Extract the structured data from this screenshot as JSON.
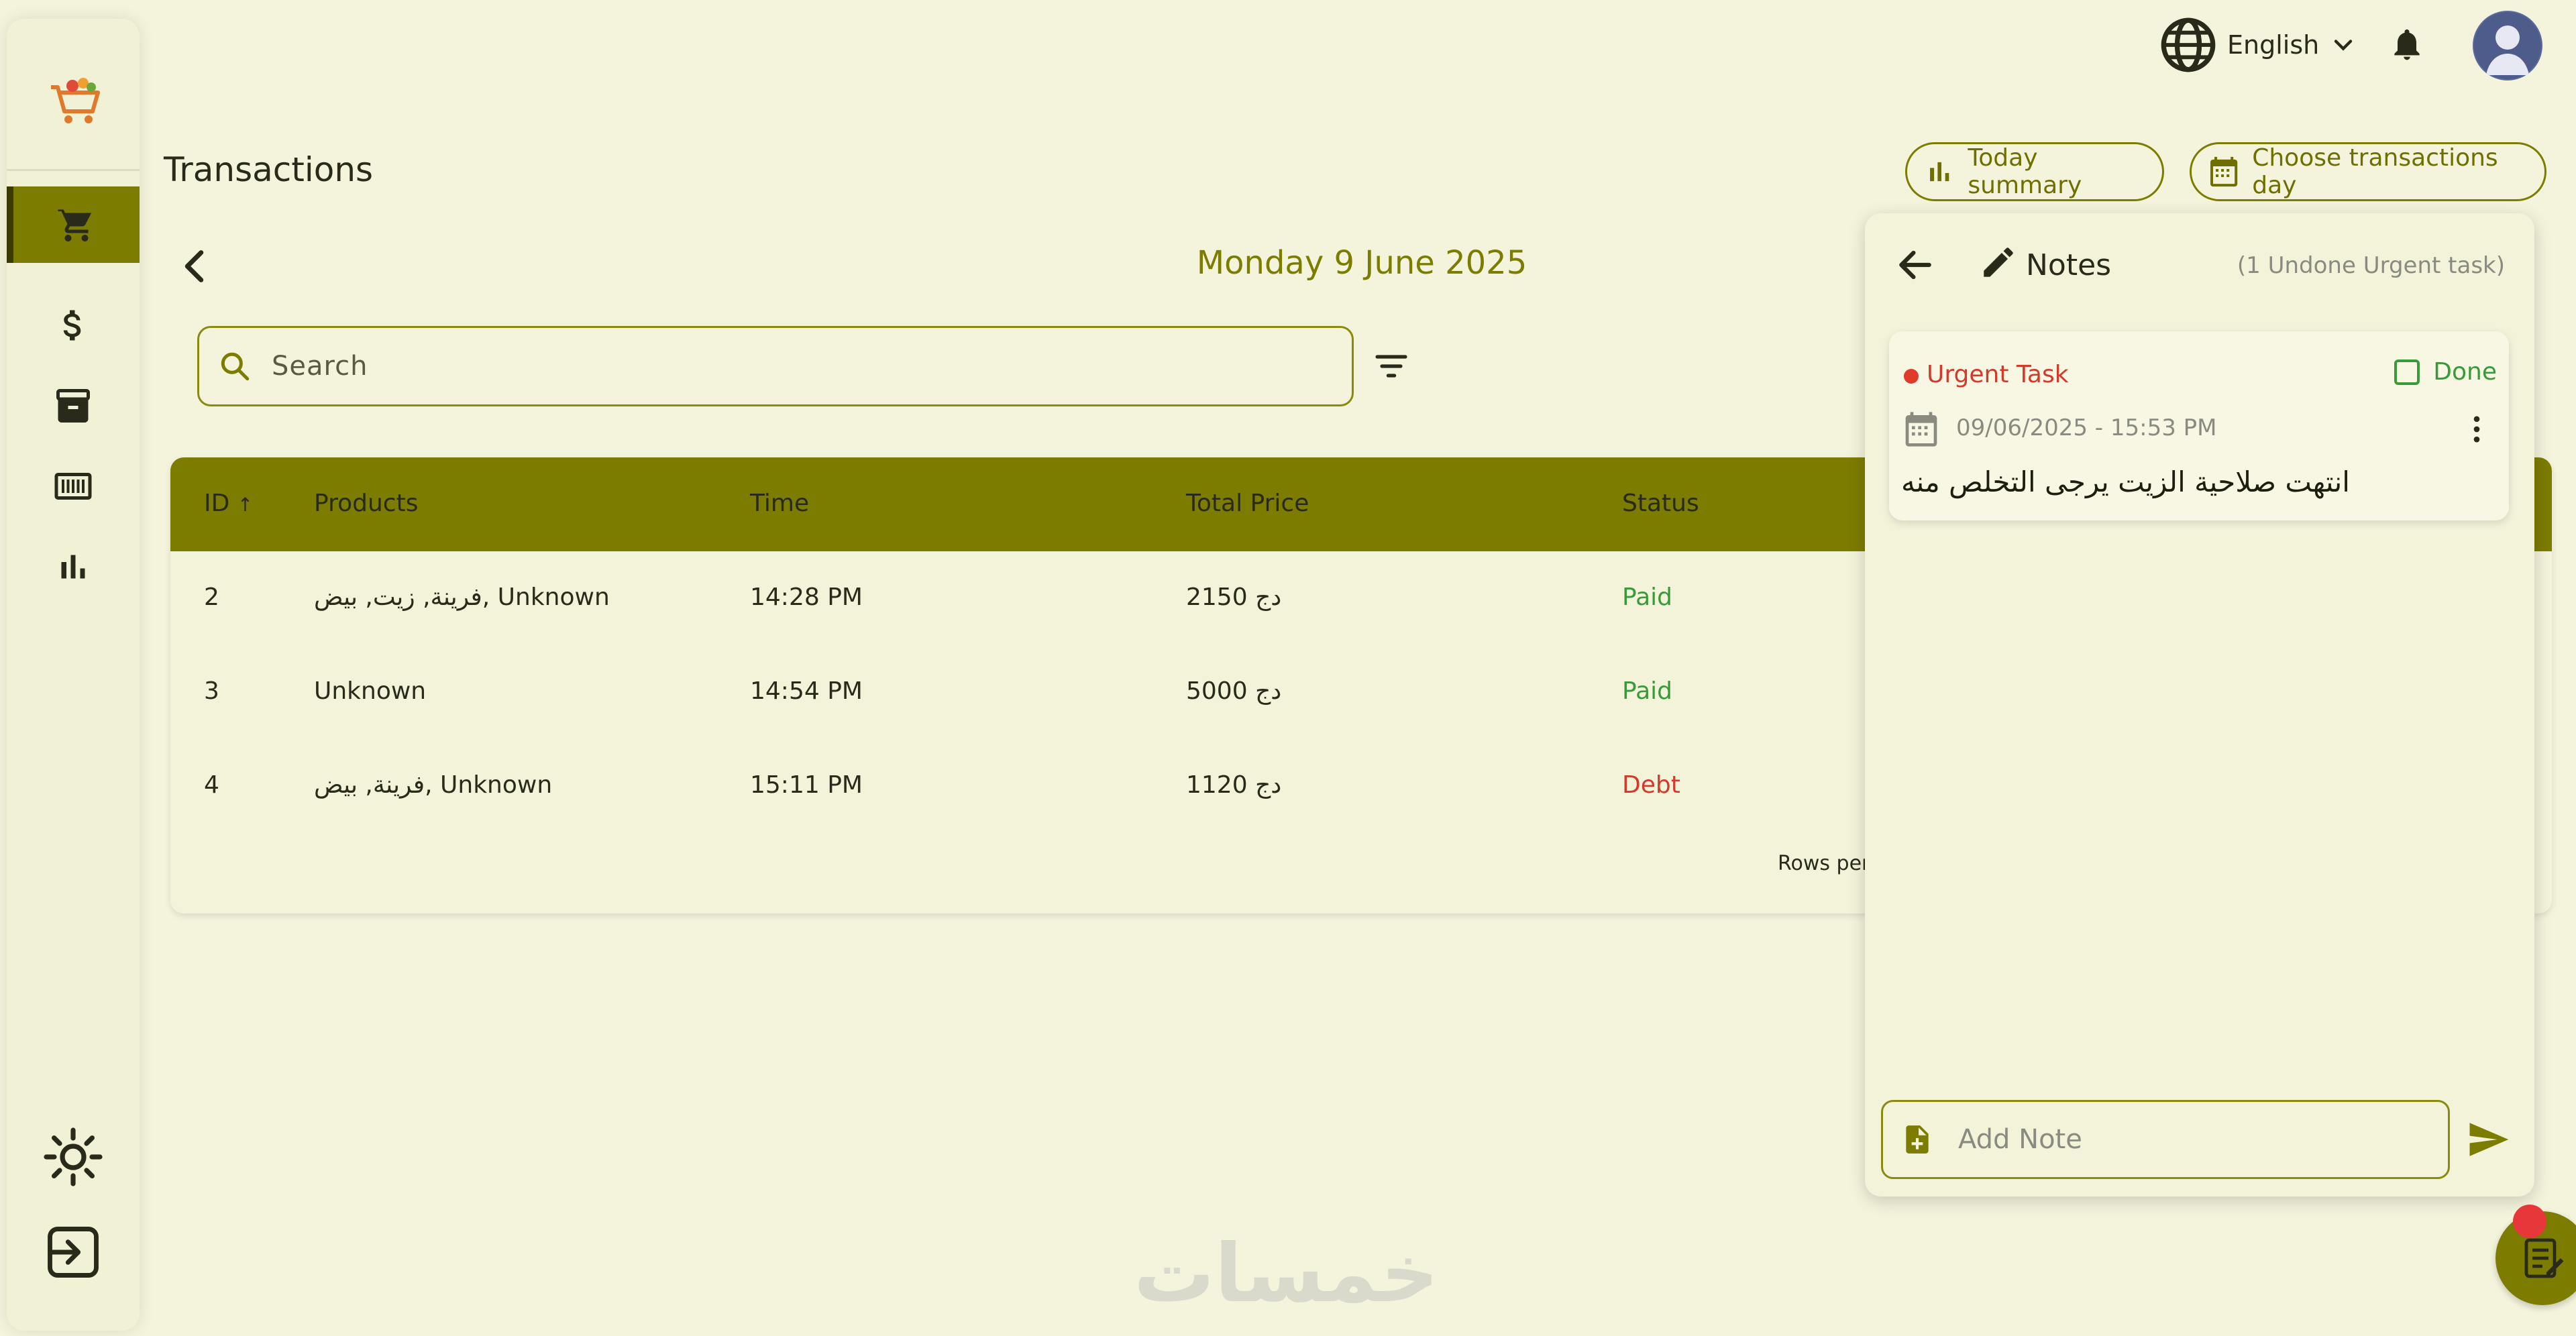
{
  "app": {
    "page_title": "Transactions"
  },
  "topbar": {
    "language_label": "English"
  },
  "actions": {
    "today_summary_label": "Today summary",
    "choose_day_label": "Choose transactions day"
  },
  "main": {
    "date_title": "Monday 9 June 2025",
    "search": {
      "placeholder": "Search",
      "value": ""
    },
    "table": {
      "columns": [
        "ID",
        "Products",
        "Time",
        "Total Price",
        "Status"
      ],
      "rows": [
        {
          "id": "2",
          "products": "فرينة, زيت, بيض, Unknown",
          "time": "14:28 PM",
          "total": "2150 دج",
          "status": "Paid"
        },
        {
          "id": "3",
          "products": "Unknown",
          "time": "14:54 PM",
          "total": "5000 دج",
          "status": "Paid"
        },
        {
          "id": "4",
          "products": "فرينة, بيض, Unknown",
          "time": "15:11 PM",
          "total": "1120 دج",
          "status": "Debt"
        }
      ],
      "rows_per_page_label": "Rows per"
    }
  },
  "notes_panel": {
    "title": "Notes",
    "urgent_count": "(1 Undone Urgent task)",
    "note": {
      "tag": "Urgent Task",
      "done_label": "Done",
      "datetime": "09/06/2025 - 15:53 PM",
      "text": "انتهت صلاحية الزيت يرجى التخلص منه"
    },
    "input": {
      "placeholder": "Add Note",
      "value": ""
    }
  },
  "watermark": "خمسات",
  "colors": {
    "accent": "#7c7c00",
    "paid": "#3a9a3a",
    "debt": "#d33a2a",
    "background": "#f4f4dc"
  },
  "icons": {
    "sidebar": [
      "cart-icon",
      "dollar-icon",
      "archive-icon",
      "barcode-icon",
      "bar-chart-icon",
      "sun-icon",
      "logout-icon"
    ],
    "topbar": [
      "globe-icon",
      "chevron-down-icon",
      "bell-icon",
      "avatar"
    ]
  }
}
